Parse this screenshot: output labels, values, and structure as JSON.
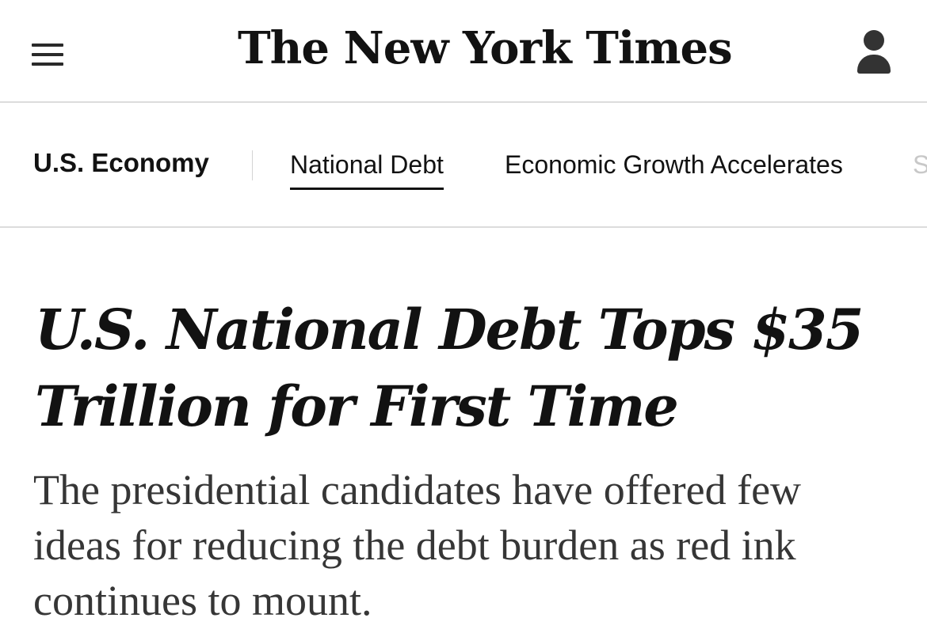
{
  "header": {
    "menu_icon": "hamburger-menu-icon",
    "logo_text": "The New York Times",
    "account_icon": "user-account-icon"
  },
  "subnav": {
    "section_label": "U.S. Economy",
    "links": [
      {
        "label": "National Debt",
        "active": true
      },
      {
        "label": "Economic Growth Accelerates",
        "active": false
      },
      {
        "label": "S",
        "active": false
      }
    ]
  },
  "article": {
    "headline": "U.S. National Debt Tops $35 Trillion for First Time",
    "summary": "The presidential candidates have offered few ideas for reducing the debt burden as red ink continues to mount."
  },
  "colors": {
    "text": "#121212",
    "summary_text": "#363636",
    "divider": "#dcdcdc"
  }
}
